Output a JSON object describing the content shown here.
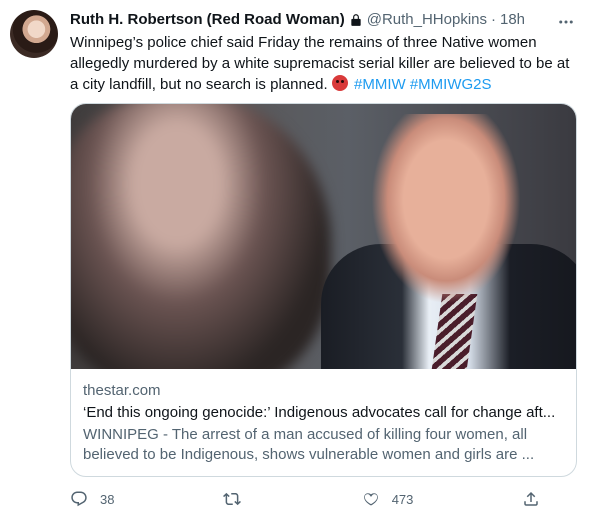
{
  "tweet": {
    "author_name": "Ruth H. Robertson (Red Road Woman)",
    "handle": "@Ruth_HHopkins",
    "separator": "·",
    "time": "18h",
    "text_main": "Winnipeg’s police chief said Friday the remains of three Native women allegedly murdered by a white supremacist serial killer are believed to be at a city landfill, but no search is planned.",
    "hashtags": [
      "#MMIW",
      "#MMIWG2S"
    ]
  },
  "card": {
    "domain": "thestar.com",
    "title": "‘End this ongoing genocide:’ Indigenous advocates call for change aft...",
    "description": "WINNIPEG - The arrest of a man accused of killing four women, all believed to be Indigenous, shows vulnerable women and girls are ..."
  },
  "actions": {
    "reply_count": "38",
    "retweet_count": "",
    "like_count": "473"
  },
  "icons": {
    "lock": "lock-icon",
    "more": "more-options-icon",
    "reply": "reply-icon",
    "retweet": "retweet-icon",
    "like": "like-icon",
    "share": "share-icon"
  },
  "colors": {
    "text": "#0f1419",
    "secondary": "#536471",
    "link": "#1d9bf0",
    "border": "#cfd9de"
  }
}
